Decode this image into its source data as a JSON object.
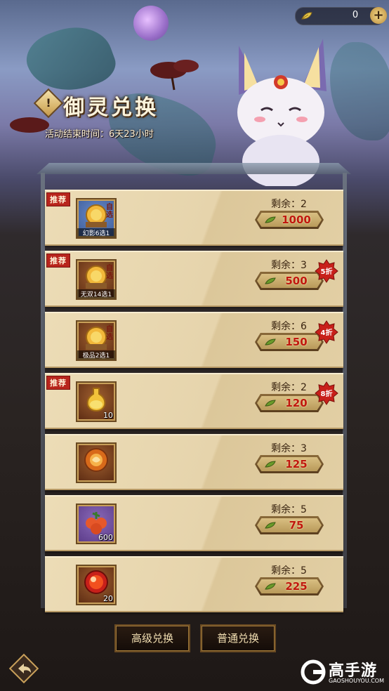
{
  "header": {
    "currency_icon": "jade-leaf-icon",
    "currency_value": "0",
    "add_label": "+",
    "title_badge": "!",
    "title": "御灵兑换",
    "end_time": "活动结束时间：6天23小时"
  },
  "rows": [
    {
      "recommend": "推荐",
      "icon": "gold-coin-chest-icon",
      "frame": "blue",
      "caption": "幻影6选1",
      "qty": "",
      "zixuan": "自选",
      "remain": "剩余：2",
      "price": "1000",
      "discount": ""
    },
    {
      "recommend": "推荐",
      "icon": "gold-coin-chest-icon",
      "frame": "orange",
      "caption": "无双14选1",
      "qty": "",
      "zixuan": "自选",
      "remain": "剩余：3",
      "price": "500",
      "discount": "5折"
    },
    {
      "recommend": "",
      "icon": "gold-coin-chest-icon",
      "frame": "orange",
      "caption": "极品2选1",
      "qty": "",
      "zixuan": "自选",
      "remain": "剩余：6",
      "price": "150",
      "discount": "4折"
    },
    {
      "recommend": "推荐",
      "icon": "potion-bottle-icon",
      "frame": "orange",
      "caption": "",
      "qty": "10",
      "zixuan": "",
      "remain": "剩余：2",
      "price": "120",
      "discount": "8折"
    },
    {
      "recommend": "",
      "icon": "fire-orb-icon",
      "frame": "orange",
      "caption": "",
      "qty": "",
      "zixuan": "",
      "remain": "剩余：3",
      "price": "125",
      "discount": ""
    },
    {
      "recommend": "",
      "icon": "fruit-cluster-icon",
      "frame": "purple",
      "caption": "",
      "qty": "600",
      "zixuan": "",
      "remain": "剩余：5",
      "price": "75",
      "discount": ""
    },
    {
      "recommend": "",
      "icon": "red-orb-icon",
      "frame": "orange",
      "caption": "",
      "qty": "20",
      "zixuan": "",
      "remain": "剩余：5",
      "price": "225",
      "discount": ""
    }
  ],
  "buttons": {
    "advanced": "高级兑换",
    "normal": "普通兑换"
  },
  "watermark": {
    "name": "高手游",
    "domain": "GAOSHOUYOU.COM"
  },
  "colors": {
    "price_text": "#c0180e",
    "recommend_bg": "#b8251c",
    "row_bg": "#e6d4ac"
  }
}
